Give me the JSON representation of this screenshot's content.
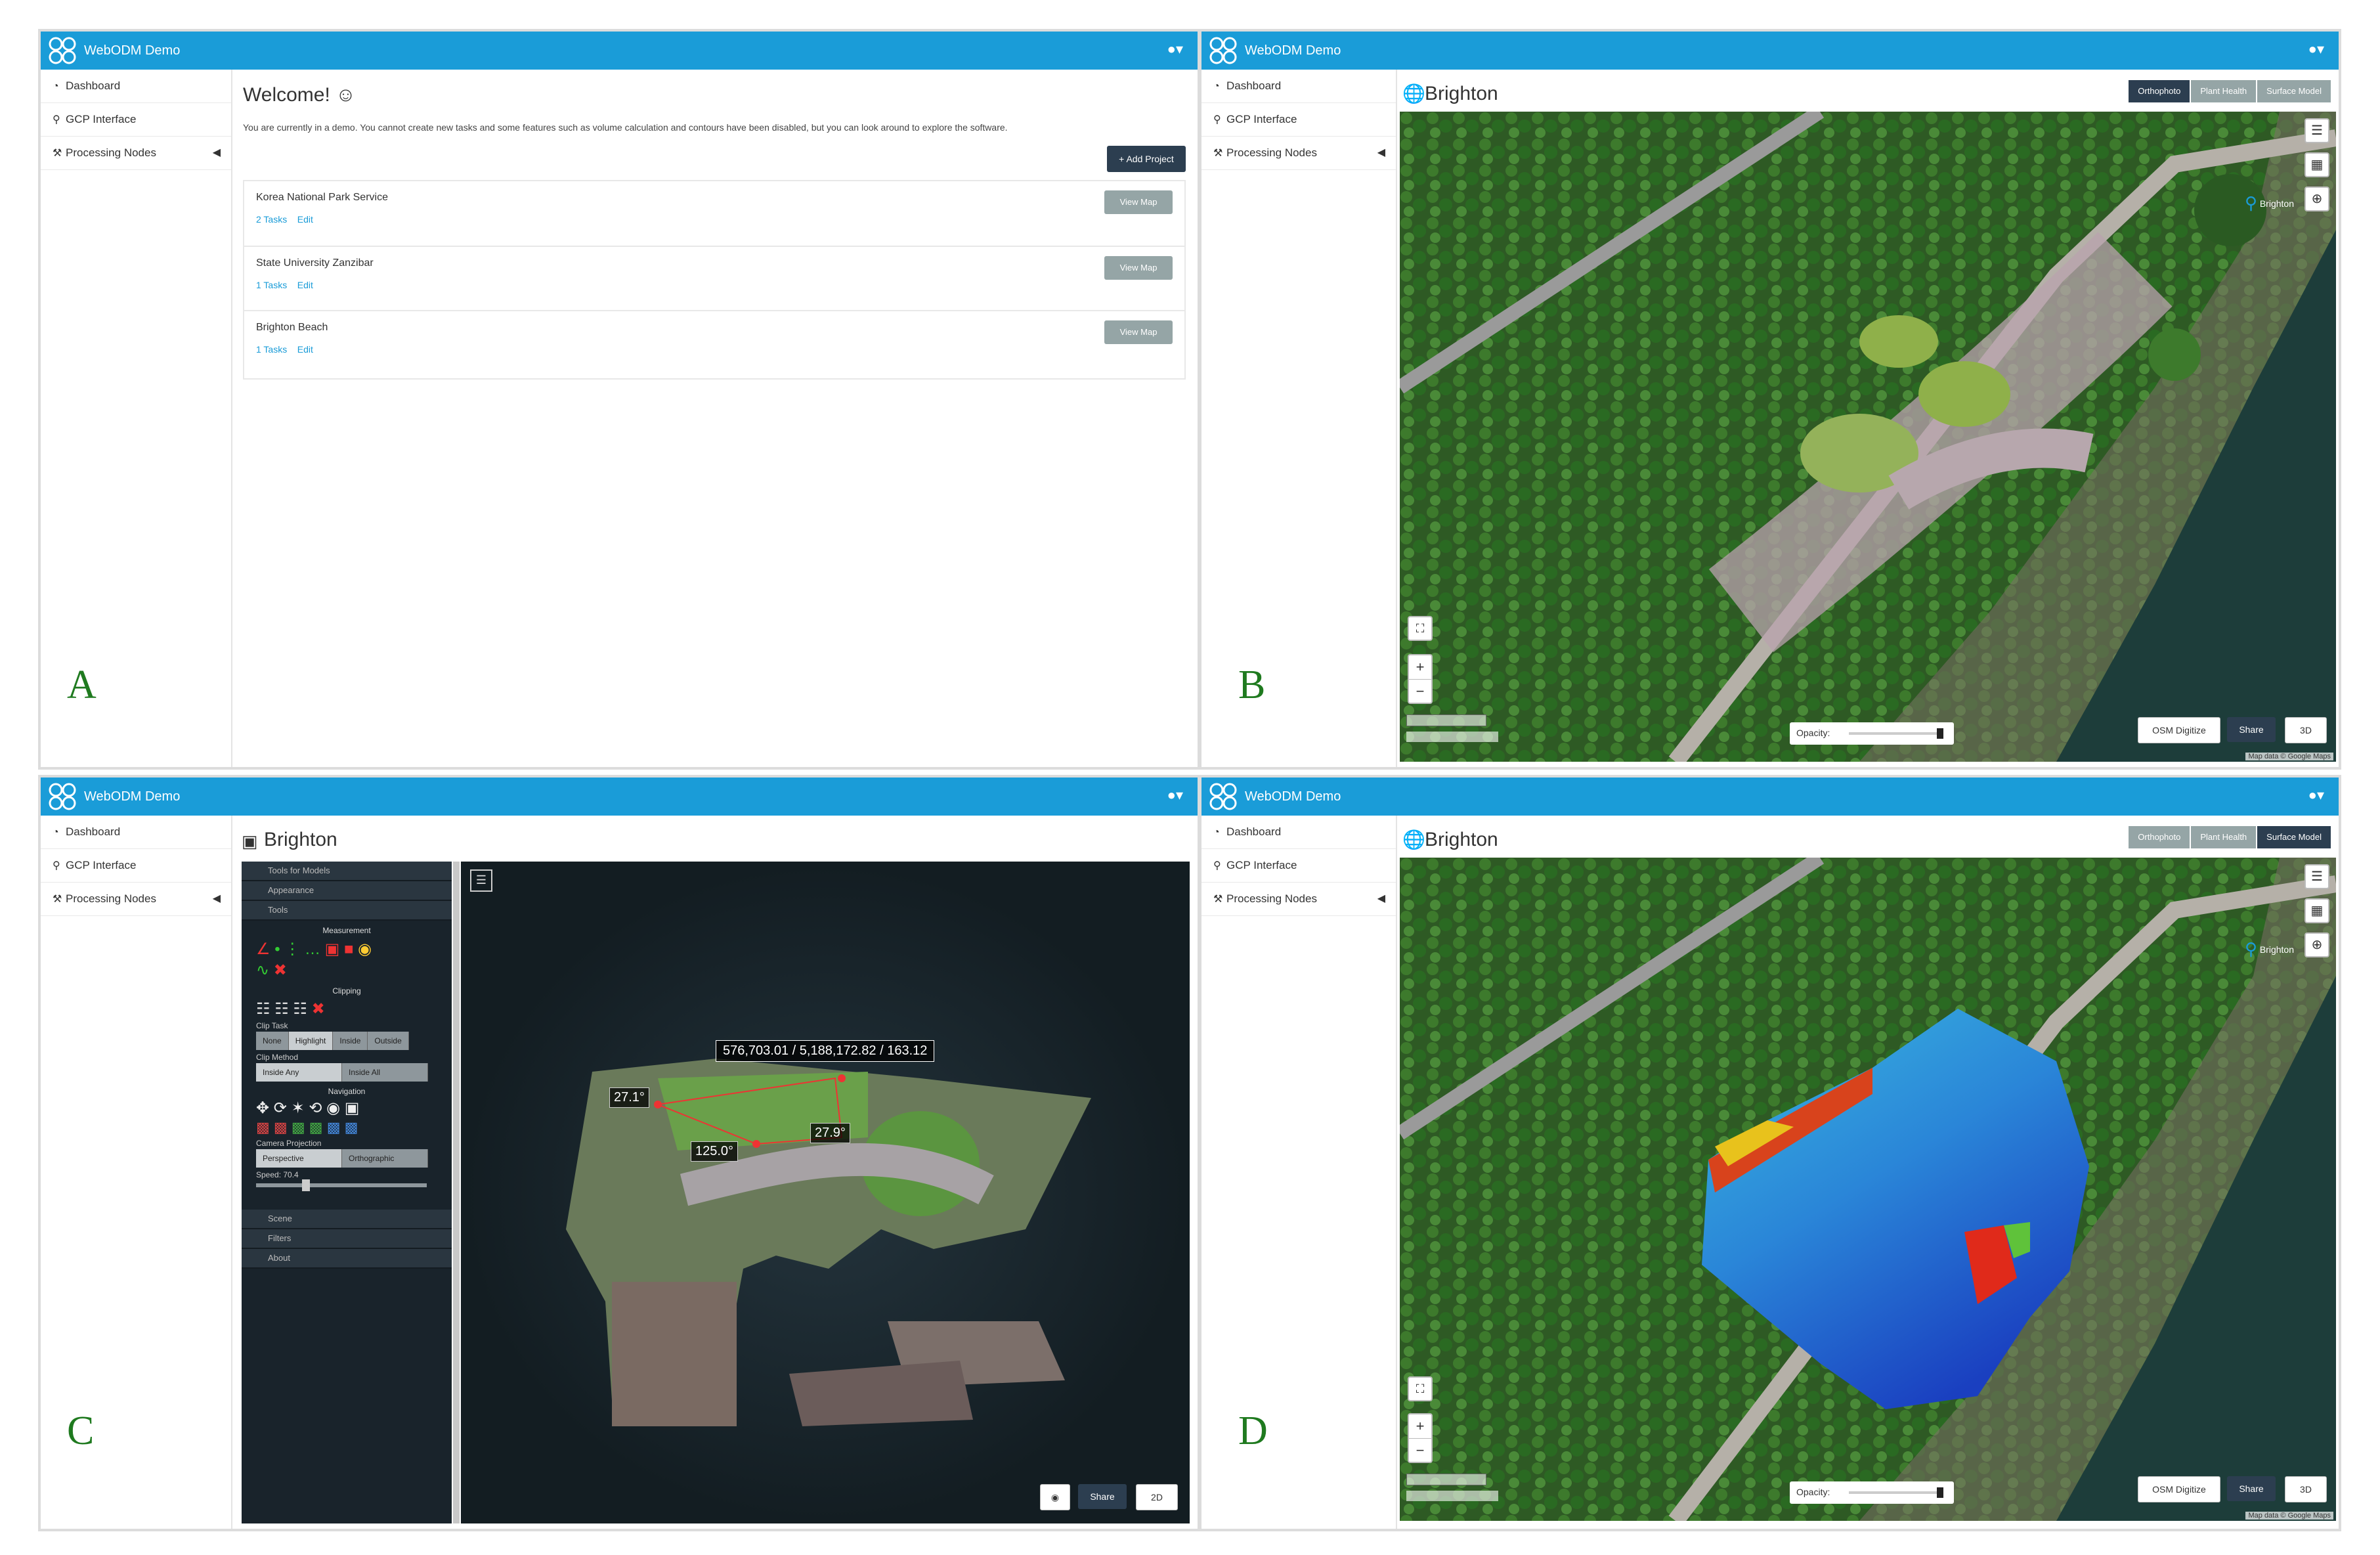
{
  "app": {
    "brand": "WebODM Demo",
    "user_icon": "user-icon"
  },
  "sidebar": {
    "items": [
      {
        "label": "Dashboard",
        "icon": "dashboard-icon"
      },
      {
        "label": "GCP Interface",
        "icon": "map-marker-icon"
      },
      {
        "label": "Processing Nodes",
        "icon": "wrench-icon"
      }
    ]
  },
  "panels": {
    "a": {
      "letter": "A"
    },
    "b": {
      "letter": "B"
    },
    "c": {
      "letter": "C"
    },
    "d": {
      "letter": "D"
    }
  },
  "dashboard": {
    "title": "Welcome! ☺",
    "notice": "You are currently in a demo. You cannot create new tasks and some features such as volume calculation and contours have been disabled, but you can look around to explore the software.",
    "add_project": "+ Add Project",
    "projects": [
      {
        "name": "Korea National Park Service",
        "tasks": "2 Tasks",
        "edit": "Edit",
        "view": "View Map"
      },
      {
        "name": "State University Zanzibar",
        "tasks": "1 Tasks",
        "edit": "Edit",
        "view": "View Map"
      },
      {
        "name": "Brighton Beach",
        "tasks": "1 Tasks",
        "edit": "Edit",
        "view": "View Map"
      }
    ]
  },
  "map": {
    "title": "Brighton",
    "tabs": [
      "Orthophoto",
      "Plant Health",
      "Surface Model"
    ],
    "opacity_label": "Opacity:",
    "osm_button": "OSM Digitize",
    "share_button": "Share",
    "three_d_button": "3D",
    "marker_label": "Brighton",
    "attribution": "Map data © Google Maps",
    "zoom_in": "+",
    "zoom_out": "−"
  },
  "viewer": {
    "title": "Brighton",
    "menu_sections": [
      "Tools for Models",
      "Appearance",
      "Tools",
      "Scene",
      "Filters",
      "About"
    ],
    "measurement_header": "Measurement",
    "clipping_header": "Clipping",
    "clip_task_label": "Clip Task",
    "clip_task_options": [
      "None",
      "Highlight",
      "Inside",
      "Outside"
    ],
    "clip_method_label": "Clip Method",
    "clip_method_options": [
      "Inside Any",
      "Inside All"
    ],
    "navigation_header": "Navigation",
    "camera_label": "Camera Projection",
    "camera_options": [
      "Perspective",
      "Orthographic"
    ],
    "speed_label": "Speed: 70.4",
    "coordinate_readout": "576,703.01 / 5,188,172.82 / 163.12",
    "angles": [
      "27.1°",
      "27.9°",
      "125.0°"
    ],
    "share_button": "Share",
    "two_d_button": "2D"
  }
}
